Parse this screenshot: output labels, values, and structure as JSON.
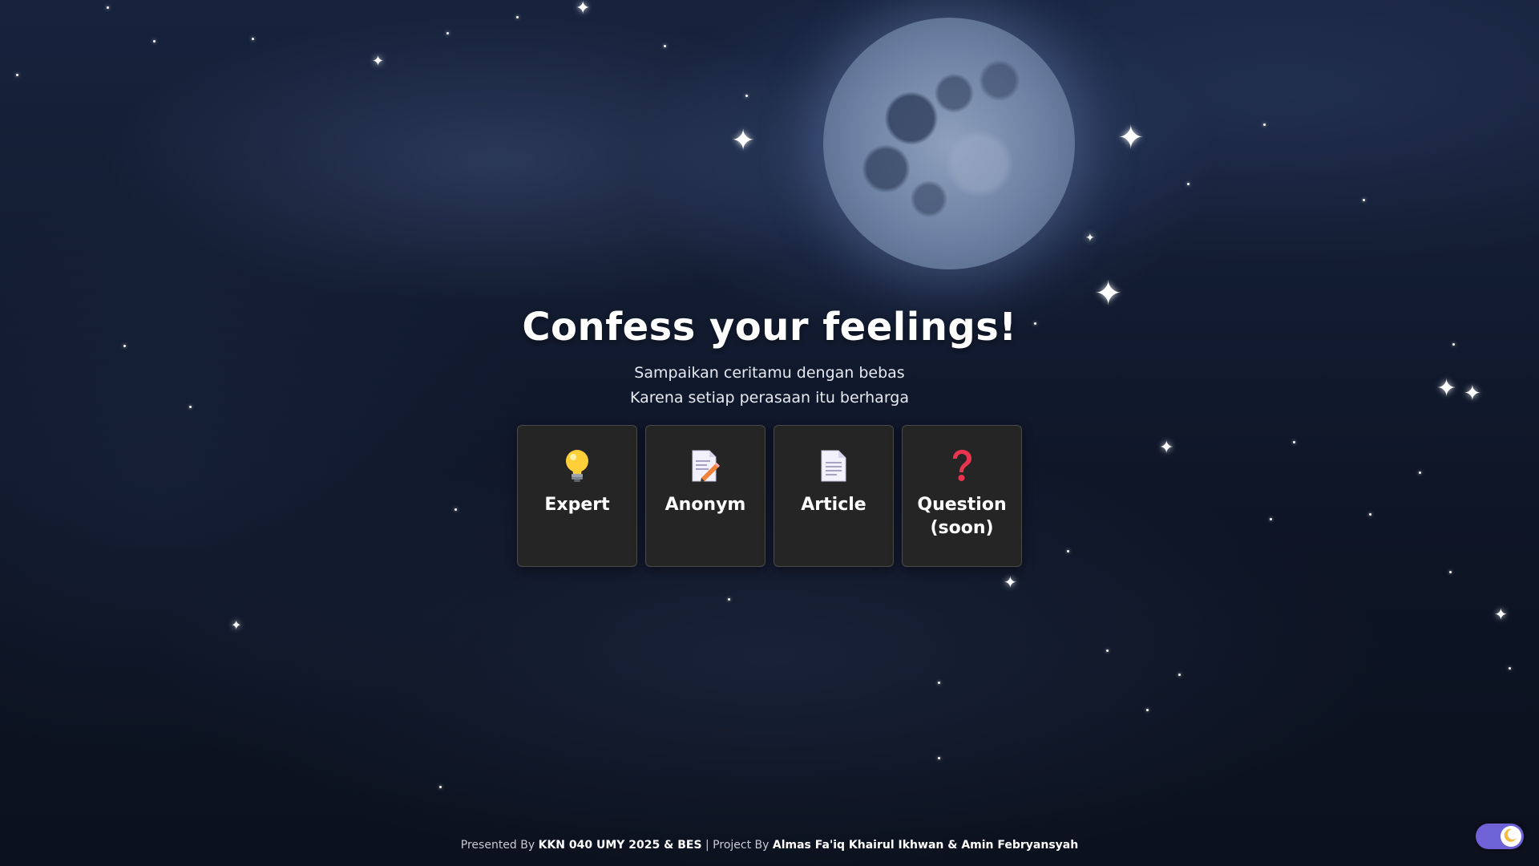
{
  "hero": {
    "title": "Confess your feelings!",
    "subtitle_line1": "Sampaikan ceritamu dengan bebas",
    "subtitle_line2": "Karena setiap perasaan itu berharga"
  },
  "cards": [
    {
      "label": "Expert",
      "icon": "lightbulb-icon"
    },
    {
      "label": "Anonym",
      "icon": "memo-pencil-icon"
    },
    {
      "label": "Article",
      "icon": "document-icon"
    },
    {
      "label": "Question (soon)",
      "icon": "question-mark-icon"
    }
  ],
  "footer": {
    "presented_prefix": "Presented By",
    "presented_by": "KKN 040 UMY 2025 & BES",
    "separator": "|",
    "project_prefix": "Project By",
    "project_by": "Almas Fa'iq Khairul Ikhwan & Amin Febryansyah"
  },
  "theme_toggle": {
    "mode": "dark",
    "icon": "moon-icon",
    "accent": "#6d63d6"
  },
  "colors": {
    "card_bg": "#252525",
    "card_border": "#4a4a4a",
    "question_mark": "#e8344e"
  }
}
